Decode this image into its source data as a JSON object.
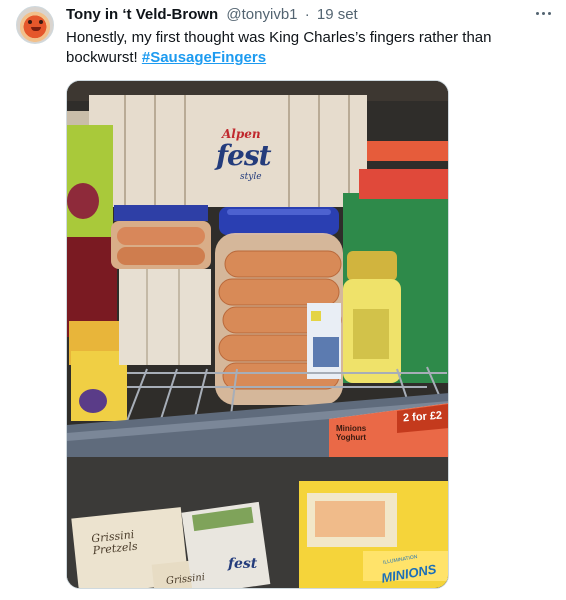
{
  "tweet": {
    "display_name": "Tony in ‘t Veld-Brown",
    "handle": "@tonyivb1",
    "separator": "·",
    "timestamp": "19 set",
    "text_before": "Honestly, my first thought was King Charles’s fingers rather than bockwurst! ",
    "hashtag": "#SausageFingers",
    "more_icon": "more-horizontal-icon",
    "avatar_icon": "profile-avatar"
  },
  "photo": {
    "box_brand_top": "Alpen",
    "box_brand_main": "fest",
    "box_brand_bottom": "style",
    "price_tag_product": "Minions\nYoghurt",
    "price_tag_deal": "2 for £2",
    "grissini_box_text": "Grissini\nPretzels",
    "grissini_box_text_2": "Grissini",
    "minions_box_text": "MINIONS",
    "minions_box_small": "ILLUMINATION",
    "small_box_brand": "fest",
    "colors": {
      "shelf_edge": "#5f6b7c",
      "price_tag": "#e8512a",
      "jar_lid": "#2a3fb2",
      "sausage": "#d88a57"
    }
  }
}
